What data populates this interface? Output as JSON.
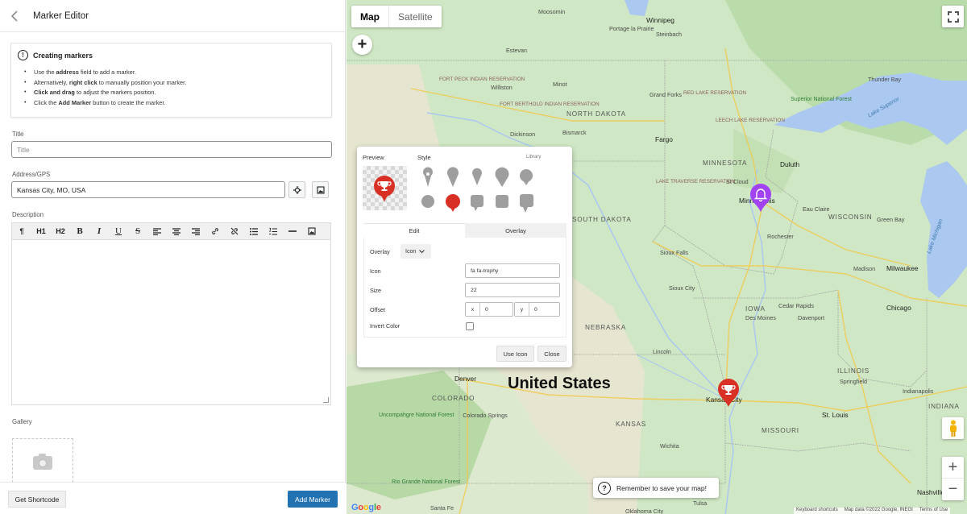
{
  "sidebar": {
    "title": "Marker Editor",
    "notice": {
      "heading": "Creating markers",
      "lines": [
        {
          "pre": "Use the ",
          "bold": "address",
          "post": " field to add a marker."
        },
        {
          "pre": "Alternatively, ",
          "bold": "right click",
          "post": " to manually position your marker."
        },
        {
          "pre": "",
          "bold": "Click and drag",
          "post": " to adjust the markers position."
        },
        {
          "pre": "Click the ",
          "bold": "Add Marker",
          "post": " button to create the marker."
        }
      ]
    },
    "title_field": {
      "label": "Title",
      "placeholder": "Title"
    },
    "address_field": {
      "label": "Address/GPS",
      "value": "Kansas City, MO, USA"
    },
    "description": {
      "label": "Description"
    },
    "toolbar": [
      "¶",
      "H1",
      "H2",
      "B",
      "I",
      "U",
      "S",
      "align-left-icon",
      "align-center-icon",
      "align-right-icon",
      "link-icon",
      "unlink-icon",
      "bullet-list-icon",
      "numbered-list-icon",
      "horizontal-rule-icon",
      "image-icon"
    ],
    "gallery": {
      "label": "Gallery"
    },
    "footer": {
      "shortcode_label": "Get Shortcode",
      "add_label": "Add Marker"
    }
  },
  "map": {
    "map_type": {
      "map": "Map",
      "satellite": "Satellite",
      "selected": "Map"
    },
    "country_label": "United States",
    "labels": {
      "moosomin": "Moosomin",
      "winnipeg": "Winnipeg",
      "portage": "Portage la Prairie",
      "steinbach": "Steinbach",
      "estevan": "Estevan",
      "thunder_bay": "Thunder Bay",
      "superior_forest": "Superior National Forest",
      "lake_superior": "Lake Superior",
      "fort_berthold": "FORT BERTHOLD INDIAN RESERVATION",
      "fort_peck": "FORT PECK INDIAN RESERVATION",
      "williston": "Williston",
      "minot": "Minot",
      "north_dakota": "NORTH DAKOTA",
      "dickinson": "Dickinson",
      "bismarck": "Bismarck",
      "grand_forks": "Grand Forks",
      "red_lake": "RED LAKE RESERVATION",
      "leech_lake": "LEECH LAKE RESERVATION",
      "fargo": "Fargo",
      "minnesota": "MINNESOTA",
      "duluth": "Duluth",
      "st_cloud": "St Cloud",
      "lake_traverse": "LAKE TRAVERSE RESERVATION",
      "minneapolis": "Minneapolis",
      "eau_claire": "Eau Claire",
      "wisconsin": "WISCONSIN",
      "green_bay": "Green Bay",
      "lake_michigan": "Lake Michigan",
      "south_dakota": "SOUTH DAKOTA",
      "rochester": "Rochester",
      "sioux_falls": "Sioux Falls",
      "madison": "Madison",
      "milwaukee": "Milwaukee",
      "sioux_city": "Sioux City",
      "iowa": "IOWA",
      "cedar_rapids": "Cedar Rapids",
      "chicago": "Chicago",
      "des_moines": "Des Moines",
      "davenport": "Davenport",
      "nebraska": "NEBRASKA",
      "lincoln": "Lincoln",
      "illinois": "ILLINOIS",
      "springfield": "Springfield",
      "indianapolis": "Indianapolis",
      "denver": "Denver",
      "colorado": "COLORADO",
      "kansas_city": "Kansas City",
      "kansas": "KANSAS",
      "st_louis": "St. Louis",
      "indiana": "INDIANA",
      "missouri": "MISSOURI",
      "wichita": "Wichita",
      "colorado_springs": "Colorado Springs",
      "uncompahgre": "Uncompahgre National Forest",
      "rio_grande": "Rio Grande National Forest",
      "nashville": "Nashville",
      "santa_fe": "Santa Fe",
      "oklahoma_city": "Oklahoma City",
      "tulsa": "Tulsa"
    },
    "save_notice": "Remember to save your map!",
    "attribution": [
      "Keyboard shortcuts",
      "Map data ©2022 Google, INEGI",
      "Terms of Use"
    ],
    "google_logo": "Google"
  },
  "popup": {
    "preview_label": "Preview",
    "style_label": "Style",
    "library_label": "Library",
    "tabs": [
      "Edit",
      "Overlay"
    ],
    "overlay": {
      "label": "Overlay",
      "value": "Icon"
    },
    "icon": {
      "label": "Icon",
      "value": "fa fa-trophy"
    },
    "size": {
      "label": "Size",
      "value": "22"
    },
    "offset": {
      "label": "Offset",
      "x_label": "x",
      "x": "0",
      "y_label": "y",
      "y": "0"
    },
    "invert": {
      "label": "Invert Color",
      "checked": false
    },
    "use_icon_label": "Use Icon",
    "close_label": "Close"
  },
  "colors": {
    "accent": "#2271b1",
    "marker_red": "#d93025",
    "marker_purple": "#a142f4",
    "map_green": "#cfe7c4",
    "water": "#aac8f0"
  }
}
